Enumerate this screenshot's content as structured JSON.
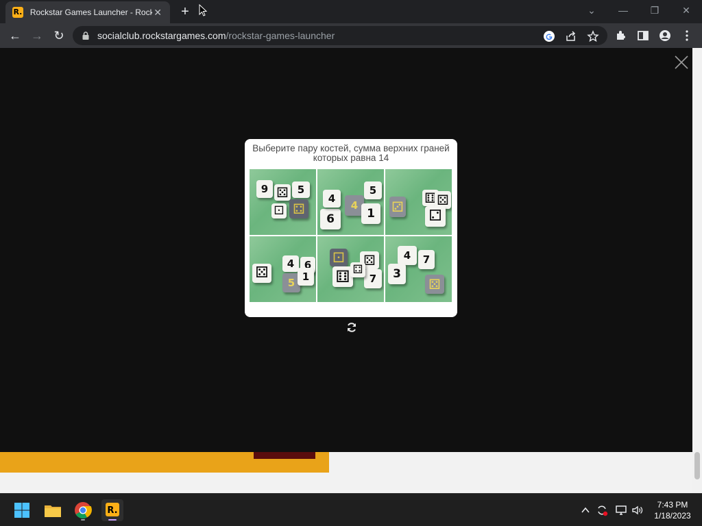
{
  "browser": {
    "tab": {
      "favicon_text": "R.",
      "title": "Rockstar Games Launcher - Rock",
      "close": "✕"
    },
    "new_tab": "+",
    "window_controls": {
      "tabsearch": "⌄",
      "minimize": "—",
      "restore": "❐",
      "close": "✕"
    },
    "nav": {
      "back": "←",
      "forward": "→",
      "reload": "↻"
    },
    "url_domain": "socialclub.rockstargames.com",
    "url_path": "/rockstar-games-launcher",
    "omnibox_icons": [
      "google-icon",
      "share-icon",
      "star-icon"
    ],
    "toolbar_icons": [
      "extensions-icon",
      "sidepanel-icon",
      "profile-icon",
      "menu-icon"
    ]
  },
  "captcha": {
    "prompt": "Выберите пару костей, сумма верхних граней которых равна 14",
    "tiles": [
      {
        "id": 1,
        "dice": [
          "9",
          "⚄",
          "5",
          "⚃",
          "⚀"
        ]
      },
      {
        "id": 2,
        "dice": [
          "6",
          "4",
          "4",
          "1",
          "5"
        ]
      },
      {
        "id": 3,
        "dice": [
          "⚂",
          "⚅",
          "⚄",
          "⚁"
        ]
      },
      {
        "id": 4,
        "dice": [
          "⚄",
          "4",
          "6",
          "5",
          "1"
        ]
      },
      {
        "id": 5,
        "dice": [
          "⚀",
          "⚄",
          "⚅",
          "7",
          "⚃"
        ]
      },
      {
        "id": 6,
        "dice": [
          "4",
          "7",
          "3",
          "⚄"
        ]
      }
    ]
  },
  "taskbar": {
    "apps": [
      "windows-start-icon",
      "file-explorer-icon",
      "chrome-icon",
      "rockstar-launcher-icon"
    ],
    "tray_icons": [
      "chevron-up-icon",
      "sync-icon",
      "network-icon",
      "volume-icon"
    ],
    "time": "7:43 PM",
    "date": "1/18/2023"
  }
}
